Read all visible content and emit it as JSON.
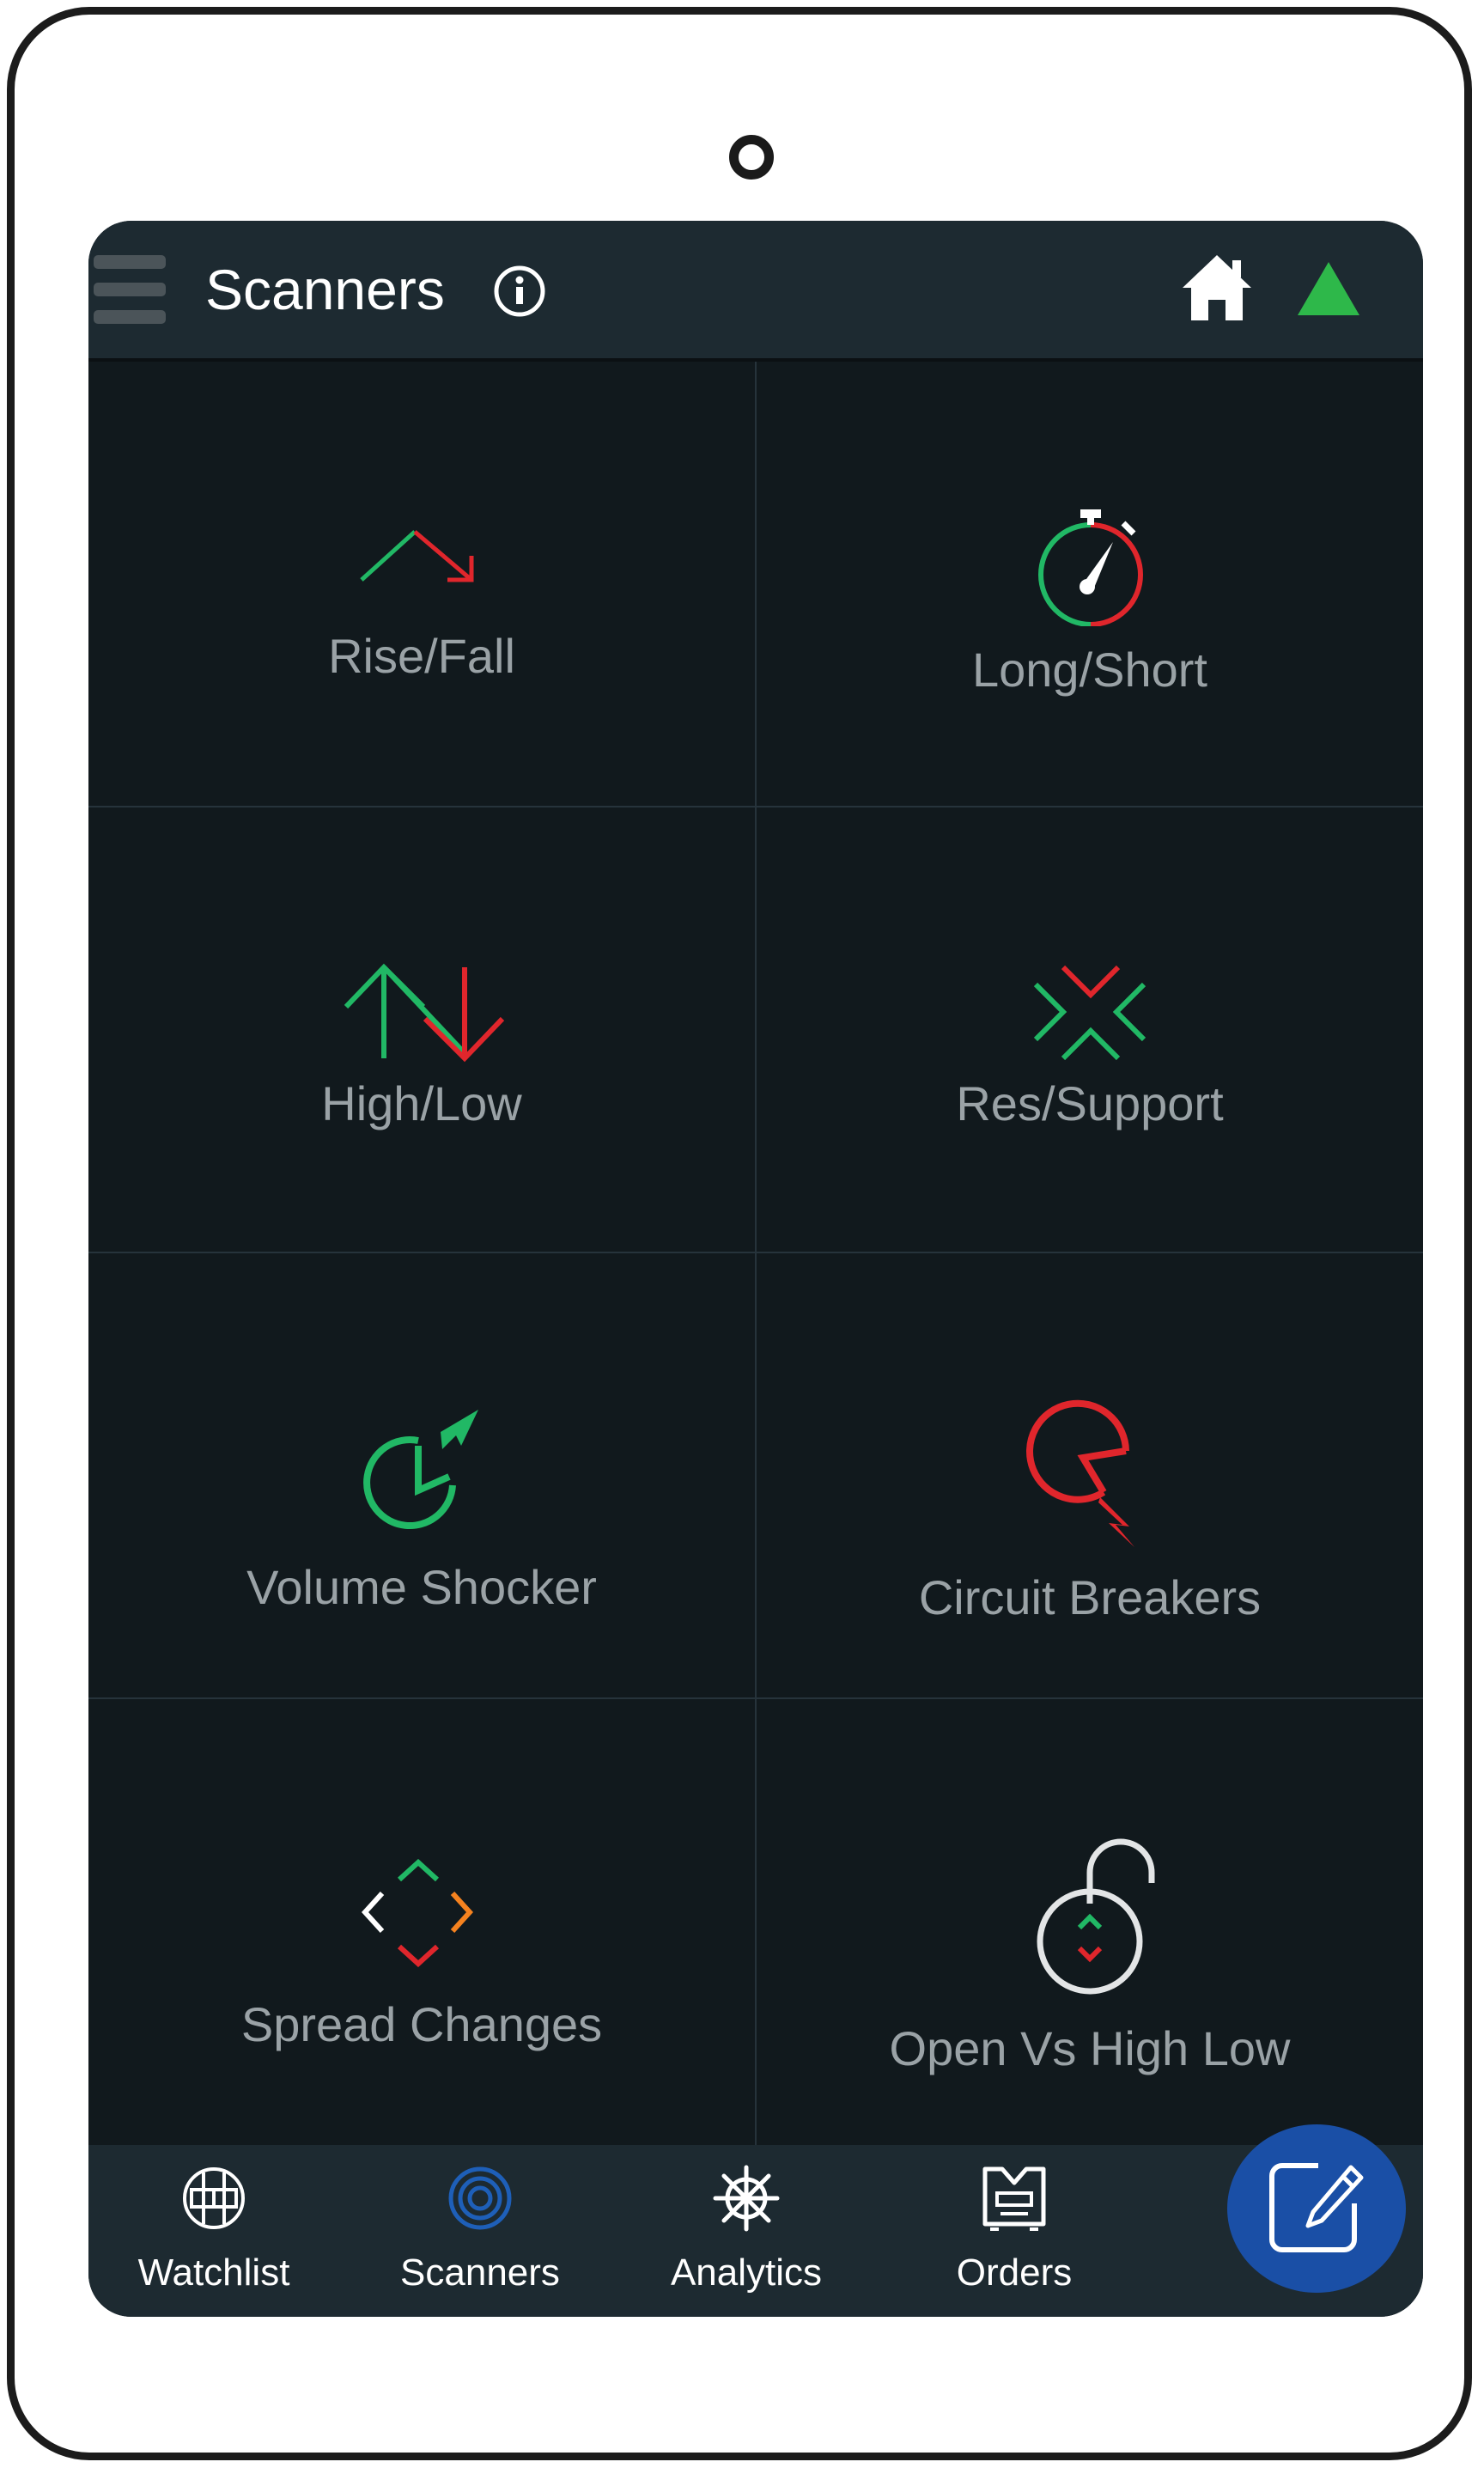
{
  "header": {
    "title": "Scanners"
  },
  "scanners": [
    {
      "label": "Rise/Fall",
      "icon": "rise-fall-icon"
    },
    {
      "label": "Long/Short",
      "icon": "stopwatch-icon"
    },
    {
      "label": "High/Low",
      "icon": "high-low-arrows-icon"
    },
    {
      "label": "Res/Support",
      "icon": "converging-chevrons-icon"
    },
    {
      "label": "Volume Shocker",
      "icon": "volume-shock-pie-icon"
    },
    {
      "label": "Circuit Breakers",
      "icon": "circuit-breaker-pie-icon"
    },
    {
      "label": "Spread Changes",
      "icon": "diamond-chevrons-icon"
    },
    {
      "label": "Open Vs High Low",
      "icon": "open-padlock-icon"
    }
  ],
  "bottom_nav": [
    {
      "label": "Watchlist",
      "icon": "watchlist-icon"
    },
    {
      "label": "Scanners",
      "icon": "target-icon",
      "active": true
    },
    {
      "label": "Analytics",
      "icon": "ships-wheel-icon"
    },
    {
      "label": "Orders",
      "icon": "orders-icon"
    }
  ],
  "fab": {
    "icon": "edit-note-icon"
  },
  "colors": {
    "header_bg": "#1d2a31",
    "grid_bg": "#11191d",
    "label": "#9aa2a6",
    "green": "#21b865",
    "red": "#e0262c",
    "orange": "#f5821f",
    "active_nav": "#1e5fb8",
    "fab": "#1a4fa6",
    "up_arrow": "#2eb84a"
  }
}
